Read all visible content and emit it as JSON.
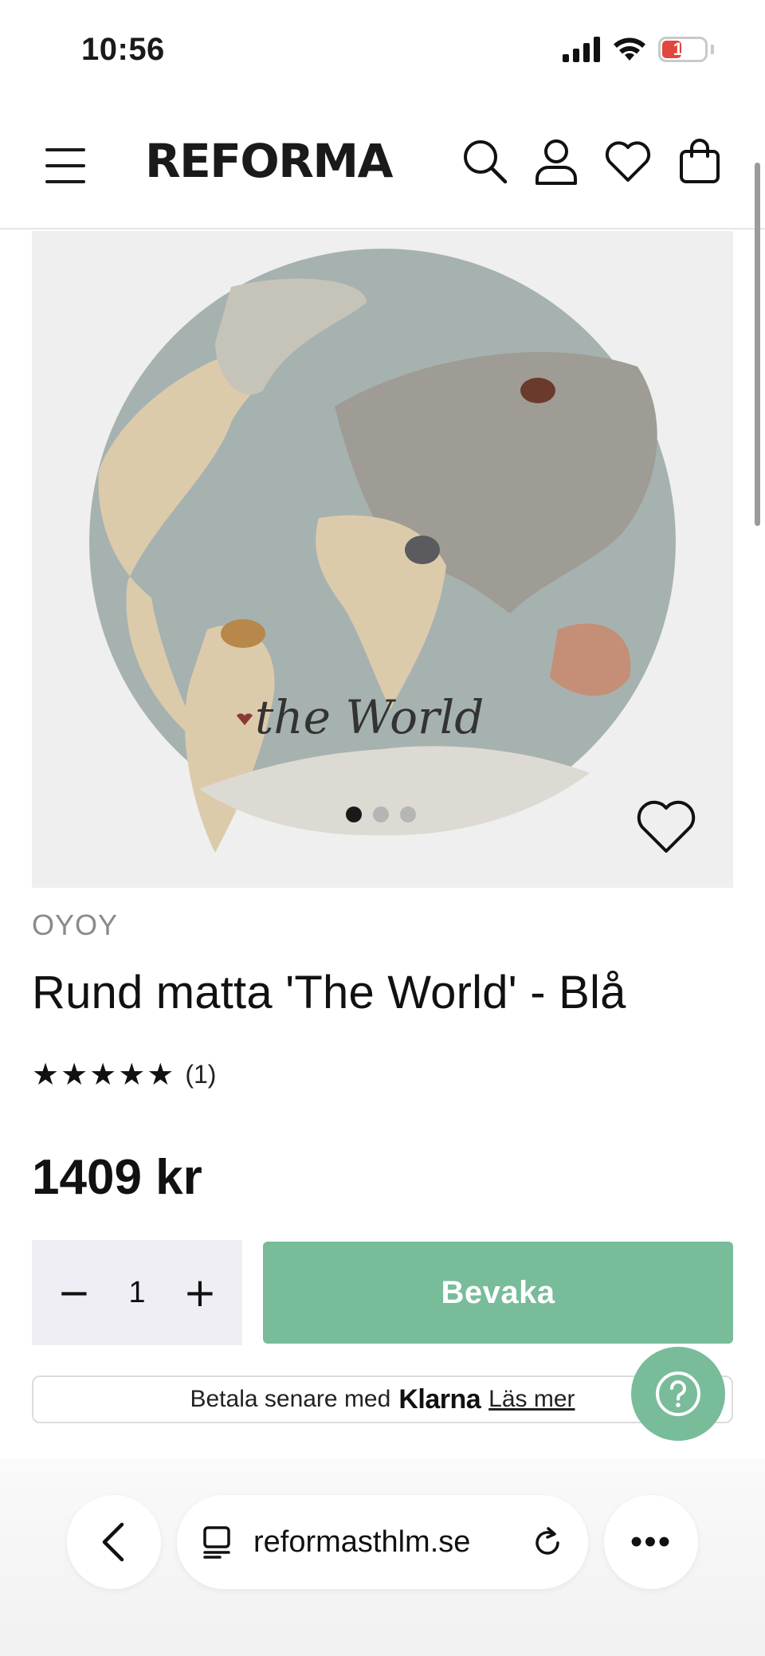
{
  "status_bar": {
    "time": "10:56",
    "battery_level": "19",
    "battery_color": "#e2463f"
  },
  "header": {
    "logo": "REFORMA",
    "icons": [
      "menu-icon",
      "search-icon",
      "account-icon",
      "heart-icon",
      "bag-icon"
    ]
  },
  "gallery": {
    "image_text": "the World",
    "dot_count": 3,
    "active_dot": 1
  },
  "product": {
    "brand": "OYOY",
    "title": "Rund matta 'The World' - Blå",
    "stars": "★★★★★",
    "rating": 5,
    "review_count": "(1)",
    "price": "1409 kr"
  },
  "purchase": {
    "decrement": "−",
    "quantity": "1",
    "increment": "+",
    "watch_label": "Bevaka",
    "accent_color": "#78bc9a"
  },
  "klarna": {
    "prefix": "Betala senare med",
    "brand": "Klarna",
    "link": "Läs mer"
  },
  "browser": {
    "url": "reformasthlm.se",
    "more": "•••"
  }
}
